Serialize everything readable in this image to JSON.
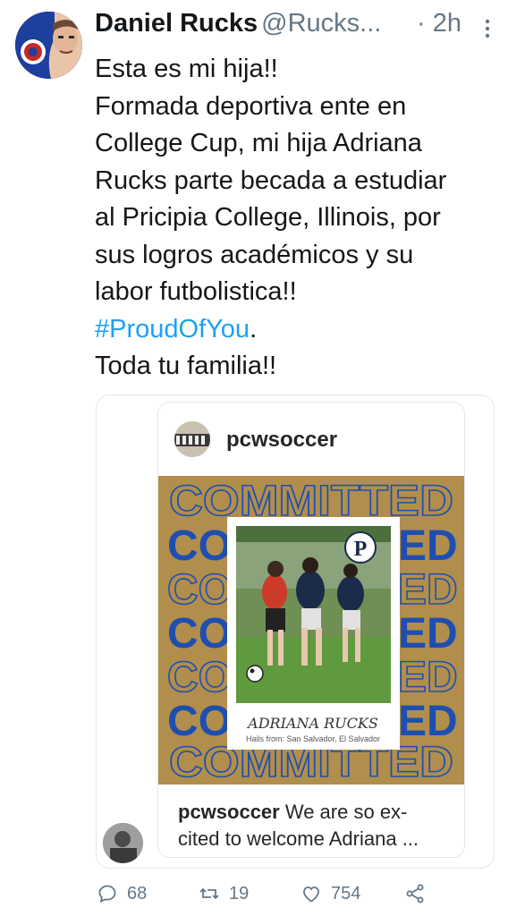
{
  "tweet": {
    "author_name": "Daniel Rucks",
    "handle": "@Rucks...",
    "time": "· 2h",
    "text_lines": [
      "Esta es mi hija!!",
      "Formada deportiva ente en",
      "College Cup, mi hija Adriana",
      "Rucks parte becada a estudiar",
      "al Pricipia College, Illinois, por",
      "sus logros académicos y su",
      "labor futbolistica!!"
    ],
    "hashtag": "#ProudOfYou",
    "hashtag_suffix": ".",
    "closing": "Toda tu familia!!"
  },
  "embed": {
    "username": "pcwsoccer",
    "poster": {
      "banner_word": "COMMITTED",
      "left_word": "CO",
      "right_word": "ED",
      "logo_letter": "P",
      "player_name": "ADRIANA RUCKS",
      "hails_from": "Hails from: San Salvador, El Salvador"
    },
    "caption_user": "pcwsoccer",
    "caption_line1": " We are so ex-",
    "caption_line2": "cited to welcome Adriana ..."
  },
  "actions": {
    "replies": "68",
    "retweets": "19",
    "likes": "754"
  },
  "colors": {
    "link": "#1da1f2",
    "poster_gold": "#b18e4c",
    "poster_blue": "#1e4fb0",
    "muted": "#657786"
  },
  "icons": [
    "more-icon",
    "reply-icon",
    "retweet-icon",
    "like-icon",
    "share-icon"
  ]
}
